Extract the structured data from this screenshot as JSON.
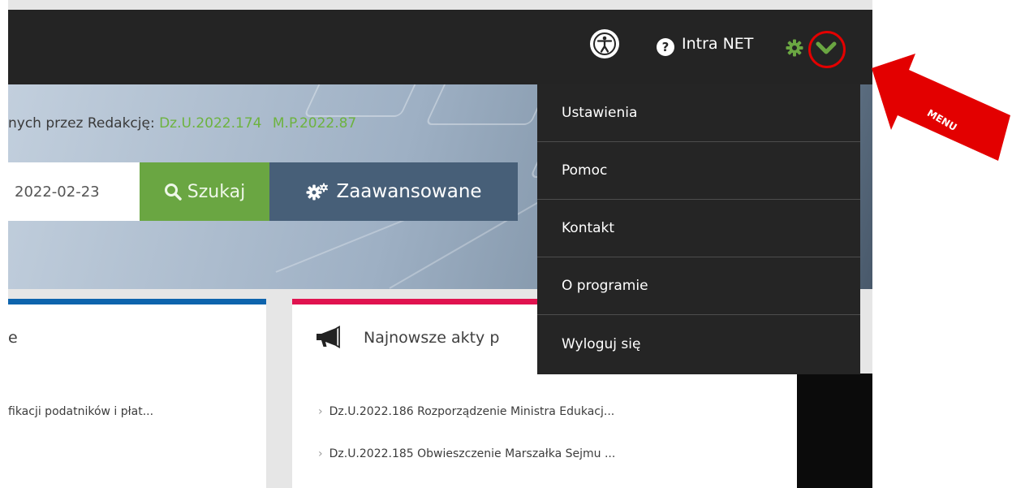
{
  "header": {
    "accessibility_icon": "accessibility-icon",
    "help_icon": "question-circle-icon",
    "help_symbol": "?",
    "user_label": "Intra NET",
    "settings_icon": "gear-icon",
    "menu_toggle_icon": "chevron-down-icon"
  },
  "hero": {
    "notice_prefix": "nych przez Redakcję:",
    "notice_links": [
      "Dz.U.2022.174",
      "M.P.2022.87"
    ],
    "date_value": "2022-02-23",
    "search_label": "Szukaj",
    "advanced_label": "Zaawansowane"
  },
  "card_left": {
    "title": "e",
    "items": [
      "fikacji podatników i płat..."
    ]
  },
  "card_right": {
    "title": "Najnowsze akty p",
    "icon": "megaphone-icon",
    "items": [
      "Dz.U.2022.186 Rozporządzenie Ministra Edukacj...",
      "Dz.U.2022.185 Obwieszczenie Marszałka Sejmu ..."
    ]
  },
  "dropdown_menu": {
    "items": [
      "Ustawienia",
      "Pomoc",
      "Kontakt",
      "O programie",
      "Wyloguj się"
    ]
  },
  "annotation": {
    "label": "MENU",
    "color": "#e30000"
  },
  "colors": {
    "topbar": "#242424",
    "accent_green": "#6aa642",
    "advanced_blue": "#475f78",
    "card_blue": "#0e64ad",
    "card_red": "#e0134f"
  }
}
